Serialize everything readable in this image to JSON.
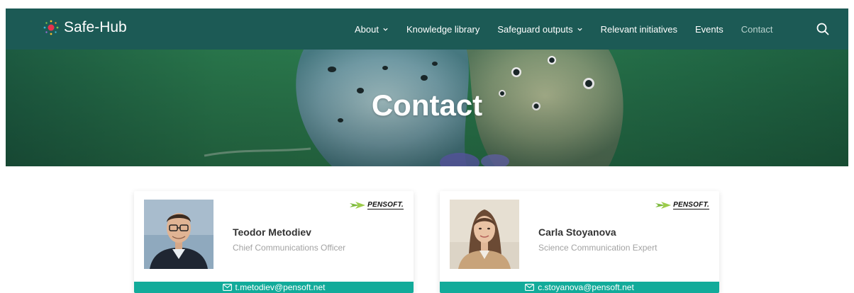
{
  "brand": {
    "name": "Safe-Hub"
  },
  "nav": {
    "items": [
      {
        "label": "About",
        "dropdown": true
      },
      {
        "label": "Knowledge library",
        "dropdown": false
      },
      {
        "label": "Safeguard outputs",
        "dropdown": true
      },
      {
        "label": "Relevant initiatives",
        "dropdown": false
      },
      {
        "label": "Events",
        "dropdown": false
      },
      {
        "label": "Contact",
        "dropdown": false,
        "active": true
      }
    ],
    "search_icon": "search-icon"
  },
  "hero": {
    "title": "Contact"
  },
  "contacts": [
    {
      "name": "Teodor Metodiev",
      "role": "Chief Communications Officer",
      "email": "t.metodiev@pensoft.net",
      "organization_logo": "PENSOFT."
    },
    {
      "name": "Carla Stoyanova",
      "role": "Science Communication Expert",
      "email": "c.stoyanova@pensoft.net",
      "organization_logo": "PENSOFT."
    }
  ],
  "colors": {
    "nav_bg": "#1c5a55",
    "accent": "#12ab9a",
    "active_link": "#b8d2ce"
  }
}
